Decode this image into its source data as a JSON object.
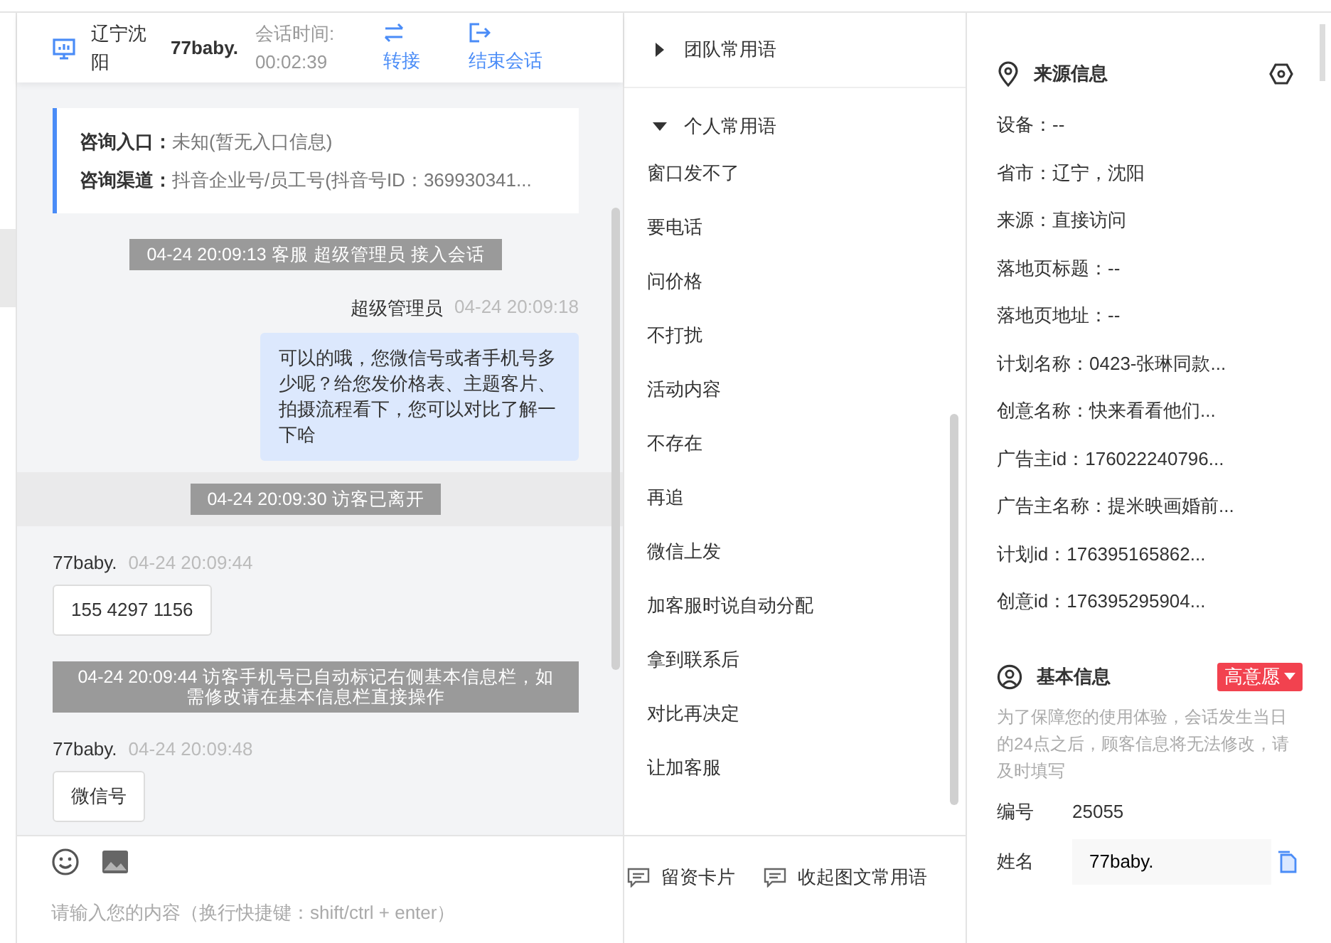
{
  "header": {
    "location": "辽宁沈阳",
    "visitor": "77baby.",
    "duration_label": "会话时间:",
    "duration": "00:02:39",
    "actions": [
      {
        "kind": "transfer",
        "label": "转接"
      },
      {
        "kind": "end",
        "label": "结束会话"
      }
    ]
  },
  "source_card": {
    "rows": [
      {
        "label": "咨询入口：",
        "value": "未知(暂无入口信息)"
      },
      {
        "label": "咨询渠道：",
        "value": "抖音企业号/员工号(抖音号ID：369930341..."
      }
    ]
  },
  "messages": [
    {
      "kind": "system",
      "banded": false,
      "text": "04-24 20:09:13 客服 超级管理员 接入会话"
    },
    {
      "kind": "agent",
      "sender": "超级管理员",
      "time": "04-24 20:09:18",
      "text": "可以的哦，您微信号或者手机号多少呢？给您发价格表、主题客片、拍摄流程看下，您可以对比了解一下哈"
    },
    {
      "kind": "system",
      "banded": true,
      "text": "04-24 20:09:30 访客已离开"
    },
    {
      "kind": "visitor",
      "sender": "77baby.",
      "time": "04-24 20:09:44",
      "text": "155 4297 1156"
    },
    {
      "kind": "system",
      "banded": false,
      "text": "04-24 20:09:44 访客手机号已自动标记右侧基本信息栏，如需修改请在基本信息栏直接操作"
    },
    {
      "kind": "visitor",
      "sender": "77baby.",
      "time": "04-24 20:09:48",
      "text": "微信号"
    }
  ],
  "composer": {
    "placeholder": "请输入您的内容（换行快捷键：shift/ctrl + enter）"
  },
  "phrases": {
    "groups": [
      {
        "label": "团队常用语",
        "expanded": false
      },
      {
        "label": "个人常用语",
        "expanded": true,
        "items": [
          "窗口发不了",
          "要电话",
          "问价格",
          "不打扰",
          "活动内容",
          "不存在",
          "再追",
          "微信上发",
          "加客服时说自动分配",
          "拿到联系后",
          "对比再决定",
          "让加客服"
        ]
      }
    ],
    "footer": [
      "留资卡片",
      "收起图文常用语"
    ]
  },
  "info": {
    "source": {
      "title": "来源信息",
      "rows": [
        "设备：--",
        "省市：辽宁，沈阳",
        "来源：直接访问",
        "落地页标题：--",
        "落地页地址：--",
        "计划名称：0423-张琳同款...",
        "创意名称：快来看看他们...",
        "广告主id：176022240796...",
        "广告主名称：提米映画婚前...",
        "计划id：176395165862...",
        "创意id：176395295904..."
      ]
    },
    "basic": {
      "title": "基本信息",
      "intent": "高意愿",
      "notice": "为了保障您的使用体验，会话发生当日的24点之后，顾客信息将无法修改，请及时填写",
      "fields": [
        {
          "kind": "text",
          "label": "编号",
          "value": "25055"
        },
        {
          "kind": "input",
          "label": "姓名",
          "value": "77baby."
        }
      ]
    }
  }
}
